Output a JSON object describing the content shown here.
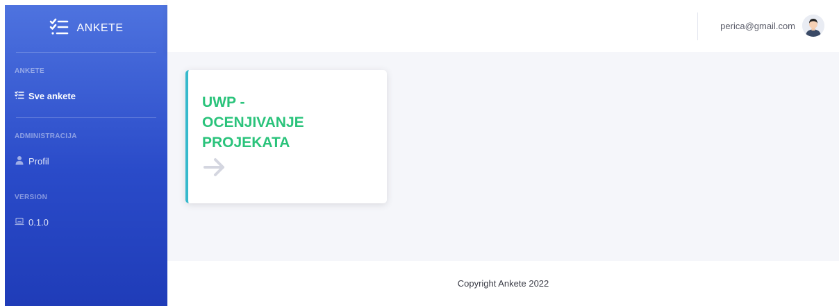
{
  "brand": {
    "name": "ANKETE",
    "icon": "list-check-icon"
  },
  "sidebar": {
    "sections": [
      {
        "heading": "ANKETE",
        "items": [
          {
            "label": "Sve ankete",
            "icon": "list-check-icon",
            "active": true
          }
        ]
      },
      {
        "heading": "ADMINISTRACIJA",
        "items": [
          {
            "label": "Profil",
            "icon": "user-icon",
            "active": false
          }
        ]
      },
      {
        "heading": "VERSION",
        "items": [
          {
            "label": "0.1.0",
            "icon": "laptop-icon",
            "active": false
          }
        ]
      }
    ]
  },
  "topbar": {
    "user_email": "perica@gmail.com",
    "avatar": "user-avatar"
  },
  "main": {
    "cards": [
      {
        "title": "UWP - OCENJIVANJE PROJEKATA",
        "icon": "arrow-right-icon"
      }
    ]
  },
  "footer": {
    "copyright": "Copyright Ankete 2022"
  },
  "colors": {
    "sidebar_gradient_top": "#4e73df",
    "sidebar_gradient_bottom": "#1f3cb8",
    "card_title": "#2ac37b",
    "card_border": "#36b9cc",
    "content_background": "#f5f6fa"
  }
}
